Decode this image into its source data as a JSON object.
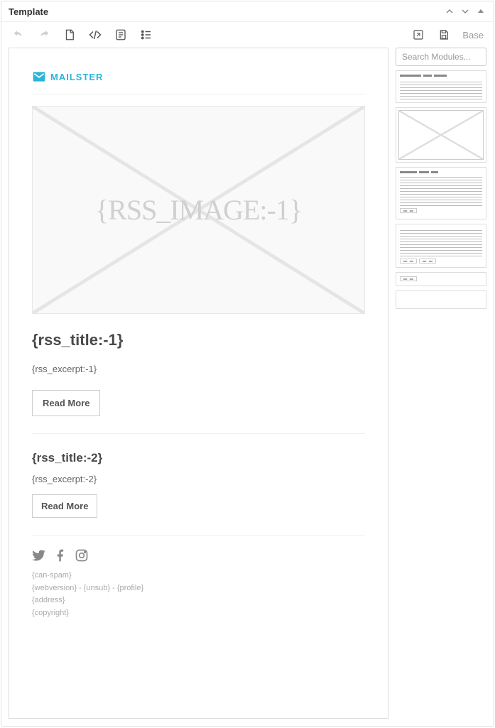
{
  "panel": {
    "title": "Template"
  },
  "toolbar": {
    "base_label": "Base"
  },
  "search": {
    "placeholder": "Search Modules..."
  },
  "logo": {
    "text": "MAILSTER"
  },
  "hero": {
    "placeholder_text": "{RSS_IMAGE:-1}"
  },
  "article1": {
    "title": "{rss_title:-1}",
    "excerpt": "{rss_excerpt:-1}",
    "button": "Read More"
  },
  "article2": {
    "title": "{rss_title:-2}",
    "excerpt": "{rss_excerpt:-2}",
    "button": "Read More"
  },
  "footer": {
    "canspam": "{can-spam}",
    "links": "{webversion}  -  {unsub}  -  {profile}",
    "address": "{address}",
    "copyright": "{copyright}"
  }
}
